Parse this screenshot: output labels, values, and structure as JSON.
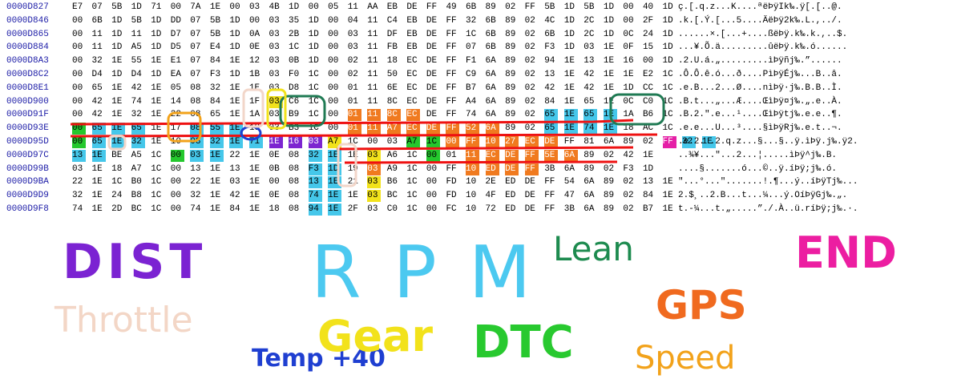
{
  "hex_dump": {
    "rows": [
      {
        "address": "0000D827",
        "bytes": [
          "E7",
          "07",
          "5B",
          "1D",
          "71",
          "00",
          "7A",
          "1E",
          "00",
          "03",
          "4B",
          "1D",
          "00",
          "05",
          "11",
          "AA",
          "EB",
          "DE",
          "FF",
          "49",
          "6B",
          "89",
          "02",
          "FF",
          "5B",
          "1D",
          "5B",
          "1D",
          "00",
          "40",
          "1D"
        ],
        "ascii": "ç.[.q.z...K....ªëÞÿIk‰.ÿ[.[..@."
      },
      {
        "address": "0000D846",
        "bytes": [
          "00",
          "6B",
          "1D",
          "5B",
          "1D",
          "DD",
          "07",
          "5B",
          "1D",
          "00",
          "03",
          "35",
          "1D",
          "00",
          "04",
          "11",
          "C4",
          "EB",
          "DE",
          "FF",
          "32",
          "6B",
          "89",
          "02",
          "4C",
          "1D",
          "2C",
          "1D",
          "00",
          "2F",
          "1D"
        ],
        "ascii": ".k.[.Ý.[...5....ÄëÞÿ2k‰.L.,../."
      },
      {
        "address": "0000D865",
        "bytes": [
          "00",
          "11",
          "1D",
          "11",
          "1D",
          "D7",
          "07",
          "5B",
          "1D",
          "0A",
          "03",
          "2B",
          "1D",
          "00",
          "03",
          "11",
          "DF",
          "EB",
          "DE",
          "FF",
          "1C",
          "6B",
          "89",
          "02",
          "6B",
          "1D",
          "2C",
          "1D",
          "0C",
          "24",
          "1D"
        ],
        "ascii": "......×.[...+....ßëÞÿ.k‰.k.,..$."
      },
      {
        "address": "0000D884",
        "bytes": [
          "00",
          "11",
          "1D",
          "A5",
          "1D",
          "D5",
          "07",
          "E4",
          "1D",
          "0E",
          "03",
          "1C",
          "1D",
          "00",
          "03",
          "11",
          "FB",
          "EB",
          "DE",
          "FF",
          "07",
          "6B",
          "89",
          "02",
          "F3",
          "1D",
          "03",
          "1E",
          "0F",
          "15",
          "1D"
        ],
        "ascii": "...¥.Õ.ä.........ûëÞÿ.k‰.ó......"
      },
      {
        "address": "0000D8A3",
        "bytes": [
          "00",
          "32",
          "1E",
          "55",
          "1E",
          "E1",
          "07",
          "84",
          "1E",
          "12",
          "03",
          "0B",
          "1D",
          "00",
          "02",
          "11",
          "18",
          "EC",
          "DE",
          "FF",
          "F1",
          "6A",
          "89",
          "02",
          "94",
          "1E",
          "13",
          "1E",
          "16",
          "00",
          "1D"
        ],
        "ascii": ".2.U.á.„.........ìÞÿñj‰.”......"
      },
      {
        "address": "0000D8C2",
        "bytes": [
          "00",
          "D4",
          "1D",
          "D4",
          "1D",
          "EA",
          "07",
          "F3",
          "1D",
          "1B",
          "03",
          "F0",
          "1C",
          "00",
          "02",
          "11",
          "50",
          "EC",
          "DE",
          "FF",
          "C9",
          "6A",
          "89",
          "02",
          "13",
          "1E",
          "42",
          "1E",
          "1E",
          "E2",
          "1C"
        ],
        "ascii": ".Ô.Ô.ê.ó...ð....PìÞÿÉj‰...B..â."
      },
      {
        "address": "0000D8E1",
        "bytes": [
          "00",
          "65",
          "1E",
          "42",
          "1E",
          "05",
          "08",
          "32",
          "1E",
          "1E",
          "03",
          "D8",
          "1C",
          "00",
          "01",
          "11",
          "6E",
          "EC",
          "DE",
          "FF",
          "B7",
          "6A",
          "89",
          "02",
          "42",
          "1E",
          "42",
          "1E",
          "1D",
          "CC",
          "1C"
        ],
        "ascii": ".e.B...2...Ø....nìÞÿ·j‰.B.B..Ì."
      },
      {
        "address": "0000D900",
        "bytes": [
          "00",
          "42",
          "1E",
          "74",
          "1E",
          "14",
          "08",
          "84",
          "1E",
          "1F",
          "03",
          "C6",
          "1C",
          "00",
          "01",
          "11",
          "8C",
          "EC",
          "DE",
          "FF",
          "A4",
          "6A",
          "89",
          "02",
          "84",
          "1E",
          "65",
          "1E",
          "0C",
          "C0",
          "1C"
        ],
        "ascii": ".B.t...„...Æ....ŒìÞÿ¤j‰.„.e..À."
      },
      {
        "address": "0000D91F",
        "bytes": [
          "00",
          "42",
          "1E",
          "32",
          "1E",
          "22",
          "08",
          "65",
          "1E",
          "1A",
          "03",
          "B9",
          "1C",
          "00",
          "01",
          "11",
          "8C",
          "EC",
          "DE",
          "FF",
          "74",
          "6A",
          "89",
          "02",
          "65",
          "1E",
          "65",
          "1E",
          "1A",
          "B6",
          "1C"
        ],
        "ascii": ".B.2.\".e...¹....ŒìÞÿtj‰.e.e..¶."
      },
      {
        "address": "0000D93E",
        "bytes": [
          "00",
          "65",
          "1E",
          "65",
          "1E",
          "17",
          "08",
          "55",
          "1E",
          "18",
          "03",
          "B3",
          "1C",
          "00",
          "01",
          "11",
          "A7",
          "EC",
          "DE",
          "FF",
          "52",
          "6A",
          "89",
          "02",
          "65",
          "1E",
          "74",
          "1E",
          "18",
          "AC",
          "1C"
        ],
        "ascii": ".e.e...U...³....§ìÞÿRj‰.e.t..¬."
      },
      {
        "address": "0000D95D",
        "bytes": [
          "00",
          "65",
          "1E",
          "32",
          "1E",
          "10",
          "08",
          "32",
          "1E",
          "71",
          "1E",
          "16",
          "03",
          "A7",
          "1C",
          "00",
          "03",
          "A7",
          "1C",
          "00",
          "FF",
          "10",
          "27",
          "EC",
          "DE",
          "FF",
          "81",
          "6A",
          "89",
          "02",
          "FF",
          "32",
          "1E"
        ],
        "ascii": ".e.2. .2.q.z...§...§..ÿ.ìÞÿ.j‰.ÿ2."
      },
      {
        "address": "0000D97C",
        "bytes": [
          "13",
          "1E",
          "BE",
          "A5",
          "1C",
          "00",
          "03",
          "1E",
          "22",
          "1E",
          "0E",
          "08",
          "32",
          "1E",
          "1E",
          "03",
          "A6",
          "1C",
          "00",
          "01",
          "11",
          "EC",
          "DE",
          "FF",
          "5E",
          "6A",
          "89",
          "02",
          "42",
          "1E"
        ],
        "ascii": "..¾¥...\"...2...¦.....ìÞÿ^j‰.B."
      },
      {
        "address": "0000D99B",
        "bytes": [
          "03",
          "1E",
          "18",
          "A7",
          "1C",
          "00",
          "13",
          "1E",
          "13",
          "1E",
          "0B",
          "08",
          "F3",
          "1D",
          "19",
          "03",
          "A9",
          "1C",
          "00",
          "FF",
          "10",
          "ED",
          "DE",
          "FF",
          "3B",
          "6A",
          "89",
          "02",
          "F3",
          "1D"
        ],
        "ascii": "....§.......ó...©..ÿ.íÞÿ;j‰.ó."
      },
      {
        "address": "0000D9BA",
        "bytes": [
          "22",
          "1E",
          "1C",
          "B0",
          "1C",
          "00",
          "22",
          "1E",
          "03",
          "1E",
          "00",
          "08",
          "13",
          "1E",
          "21",
          "03",
          "B6",
          "1C",
          "00",
          "FD",
          "10",
          "2E",
          "ED",
          "DE",
          "FF",
          "54",
          "6A",
          "89",
          "02",
          "13",
          "1E"
        ],
        "ascii": "\"...°...\".......!.¶...ý..íÞÿTj‰..."
      },
      {
        "address": "0000D9D9",
        "bytes": [
          "32",
          "1E",
          "24",
          "B8",
          "1C",
          "00",
          "32",
          "1E",
          "42",
          "1E",
          "0E",
          "08",
          "74",
          "1E",
          "1E",
          "03",
          "BC",
          "1C",
          "00",
          "FD",
          "10",
          "4F",
          "ED",
          "DE",
          "FF",
          "47",
          "6A",
          "89",
          "02",
          "84",
          "1E"
        ],
        "ascii": "2.$¸..2.B...t...¼...ý.OíÞÿGj‰.„."
      },
      {
        "address": "0000D9F8",
        "bytes": [
          "74",
          "1E",
          "2D",
          "BC",
          "1C",
          "00",
          "74",
          "1E",
          "84",
          "1E",
          "18",
          "08",
          "94",
          "1E",
          "2F",
          "03",
          "C0",
          "1C",
          "00",
          "FC",
          "10",
          "72",
          "ED",
          "DE",
          "FF",
          "3B",
          "6A",
          "89",
          "02",
          "B7",
          "1E"
        ],
        "ascii": "t.-¼...t.„.....”./.À..ü.ríÞÿ;j‰.·."
      }
    ]
  },
  "annotations": {
    "dist": {
      "text": "DIST",
      "color": "#7b23d2"
    },
    "throttle": {
      "text": "Throttle",
      "color": "#f3d6c6"
    },
    "rpm": {
      "text": "RPM",
      "color": "#4cc9f0"
    },
    "temp": {
      "text": "Temp +40",
      "color": "#1f3fd1"
    },
    "gear": {
      "text": "Gear",
      "color": "#f2e21b"
    },
    "dtc": {
      "text": "DTC",
      "color": "#28c92f"
    },
    "lean": {
      "text": "Lean",
      "color": "#1d8b4f"
    },
    "end": {
      "text": "END",
      "color": "#ec1ea1"
    },
    "gps": {
      "text": "GPS",
      "color": "#f06a1f"
    },
    "speed": {
      "text": "Speed",
      "color": "#f2a21a"
    }
  }
}
